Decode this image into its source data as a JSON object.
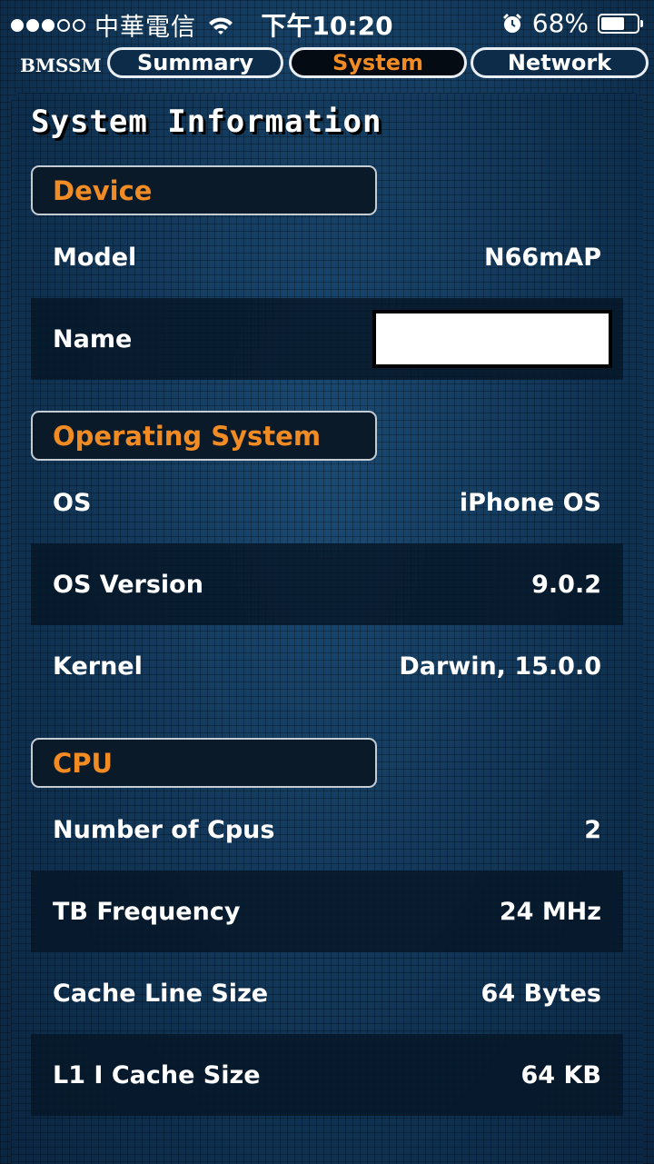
{
  "status_bar": {
    "carrier": "中華電信",
    "time": "下午10:20",
    "battery_percent_text": "68%",
    "battery_level": 0.68,
    "signal_bars_filled": 3,
    "signal_bars_total": 5
  },
  "tabbar": {
    "app_name": "BMSSM",
    "tabs": [
      {
        "label": "Summary",
        "active": false
      },
      {
        "label": "System",
        "active": true
      },
      {
        "label": "Network",
        "active": false
      }
    ]
  },
  "page": {
    "title": "System Information",
    "sections": [
      {
        "header": "Device",
        "rows": [
          {
            "label": "Model",
            "value": "N66mAP"
          },
          {
            "label": "Name",
            "value": ""
          }
        ]
      },
      {
        "header": "Operating System",
        "rows": [
          {
            "label": "OS",
            "value": "iPhone OS"
          },
          {
            "label": "OS Version",
            "value": "9.0.2"
          },
          {
            "label": "Kernel",
            "value": "Darwin, 15.0.0"
          }
        ]
      },
      {
        "header": "CPU",
        "rows": [
          {
            "label": "Number of Cpus",
            "value": "2"
          },
          {
            "label": "TB Frequency",
            "value": "24 MHz"
          },
          {
            "label": "Cache Line Size",
            "value": "64 Bytes"
          },
          {
            "label": "L1 I Cache Size",
            "value": "64 KB"
          }
        ]
      }
    ]
  },
  "colors": {
    "accent": "#f18b23",
    "background": "#123a5e",
    "text": "#ffffff"
  }
}
